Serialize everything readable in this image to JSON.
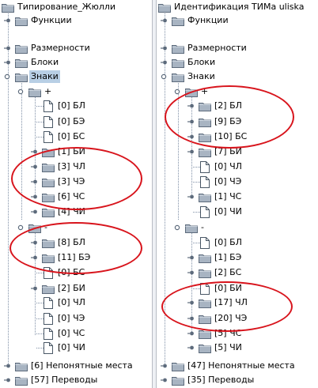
{
  "left_tree": {
    "root": "Типирование_Жюлли",
    "items": [
      {
        "label": "Функции",
        "expanded": false
      },
      {
        "label": "Размерности",
        "expanded": false
      },
      {
        "label": "Блоки",
        "expanded": false
      },
      {
        "label": "Знаки",
        "expanded": true,
        "selected": true
      },
      {
        "label": "+",
        "expanded": true
      },
      {
        "label": "[0] БЛ"
      },
      {
        "label": "[0] БЭ"
      },
      {
        "label": "[0] БС"
      },
      {
        "label": "[1] БИ",
        "expanded": false
      },
      {
        "label": "[3] ЧЛ",
        "expanded": false
      },
      {
        "label": "[3] ЧЭ",
        "expanded": false
      },
      {
        "label": "[6] ЧС",
        "expanded": false
      },
      {
        "label": "[4] ЧИ",
        "expanded": false
      },
      {
        "label": "-",
        "expanded": true
      },
      {
        "label": "[8] БЛ",
        "expanded": false
      },
      {
        "label": "[11] БЭ",
        "expanded": false
      },
      {
        "label": "[0] БС"
      },
      {
        "label": "[2] БИ",
        "expanded": false
      },
      {
        "label": "[0] ЧЛ"
      },
      {
        "label": "[0] ЧЭ"
      },
      {
        "label": "[0] ЧС"
      },
      {
        "label": "[0] ЧИ"
      },
      {
        "label": "[6] Непонятные места",
        "expanded": false
      },
      {
        "label": "[57] Переводы",
        "expanded": false
      }
    ]
  },
  "right_tree": {
    "root": "Идентификация ТИМа uliska",
    "items": [
      {
        "label": "Функции",
        "expanded": false
      },
      {
        "label": "Размерности",
        "expanded": false
      },
      {
        "label": "Блоки",
        "expanded": false
      },
      {
        "label": "Знаки",
        "expanded": true
      },
      {
        "label": "+",
        "expanded": true
      },
      {
        "label": "[2] БЛ",
        "expanded": false
      },
      {
        "label": "[9] БЭ",
        "expanded": false
      },
      {
        "label": "[10] БС",
        "expanded": false
      },
      {
        "label": "[7] БИ",
        "expanded": false
      },
      {
        "label": "[0] ЧЛ"
      },
      {
        "label": "[0] ЧЭ"
      },
      {
        "label": "[1] ЧС",
        "expanded": false
      },
      {
        "label": "[0] ЧИ"
      },
      {
        "label": "-",
        "expanded": true
      },
      {
        "label": "[0] БЛ"
      },
      {
        "label": "[1] БЭ",
        "expanded": false
      },
      {
        "label": "[2] БС",
        "expanded": false
      },
      {
        "label": "[0] БИ"
      },
      {
        "label": "[17] ЧЛ",
        "expanded": false
      },
      {
        "label": "[20] ЧЭ",
        "expanded": false
      },
      {
        "label": "[5] ЧС",
        "expanded": false
      },
      {
        "label": "[5] ЧИ",
        "expanded": false
      },
      {
        "label": "[47] Непонятные места",
        "expanded": false
      },
      {
        "label": "[35] Переводы",
        "expanded": false
      }
    ]
  },
  "colors": {
    "selection": "#b8cfe5",
    "annotation_ellipse": "#d8141c",
    "folder": "#a8b4c2",
    "connector": "#7f8fa6"
  }
}
